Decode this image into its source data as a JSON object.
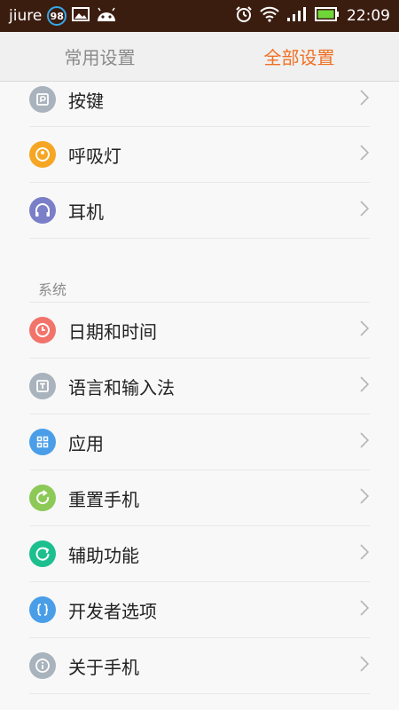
{
  "status_bar": {
    "carrier": "jiure",
    "badge": "98",
    "time": "22:09"
  },
  "tabs": {
    "common": "常用设置",
    "all": "全部设置"
  },
  "items_top": [
    {
      "label": "按键",
      "icon": "key-icon",
      "color": "#a9b3bd"
    },
    {
      "label": "呼吸灯",
      "icon": "breathing-light-icon",
      "color": "#f6a623"
    },
    {
      "label": "耳机",
      "icon": "headphones-icon",
      "color": "#7a7fc7"
    }
  ],
  "section_system": "系统",
  "items_system": [
    {
      "label": "日期和时间",
      "icon": "clock-icon",
      "color": "#f2736a"
    },
    {
      "label": "语言和输入法",
      "icon": "text-input-icon",
      "color": "#a9b3bd"
    },
    {
      "label": "应用",
      "icon": "apps-grid-icon",
      "color": "#4a9ee8"
    },
    {
      "label": "重置手机",
      "icon": "reset-icon",
      "color": "#8cc957"
    },
    {
      "label": "辅助功能",
      "icon": "accessibility-icon",
      "color": "#1dbf8f"
    },
    {
      "label": "开发者选项",
      "icon": "developer-braces-icon",
      "color": "#4a9ee8"
    },
    {
      "label": "关于手机",
      "icon": "info-icon",
      "color": "#a9b3bd"
    }
  ]
}
